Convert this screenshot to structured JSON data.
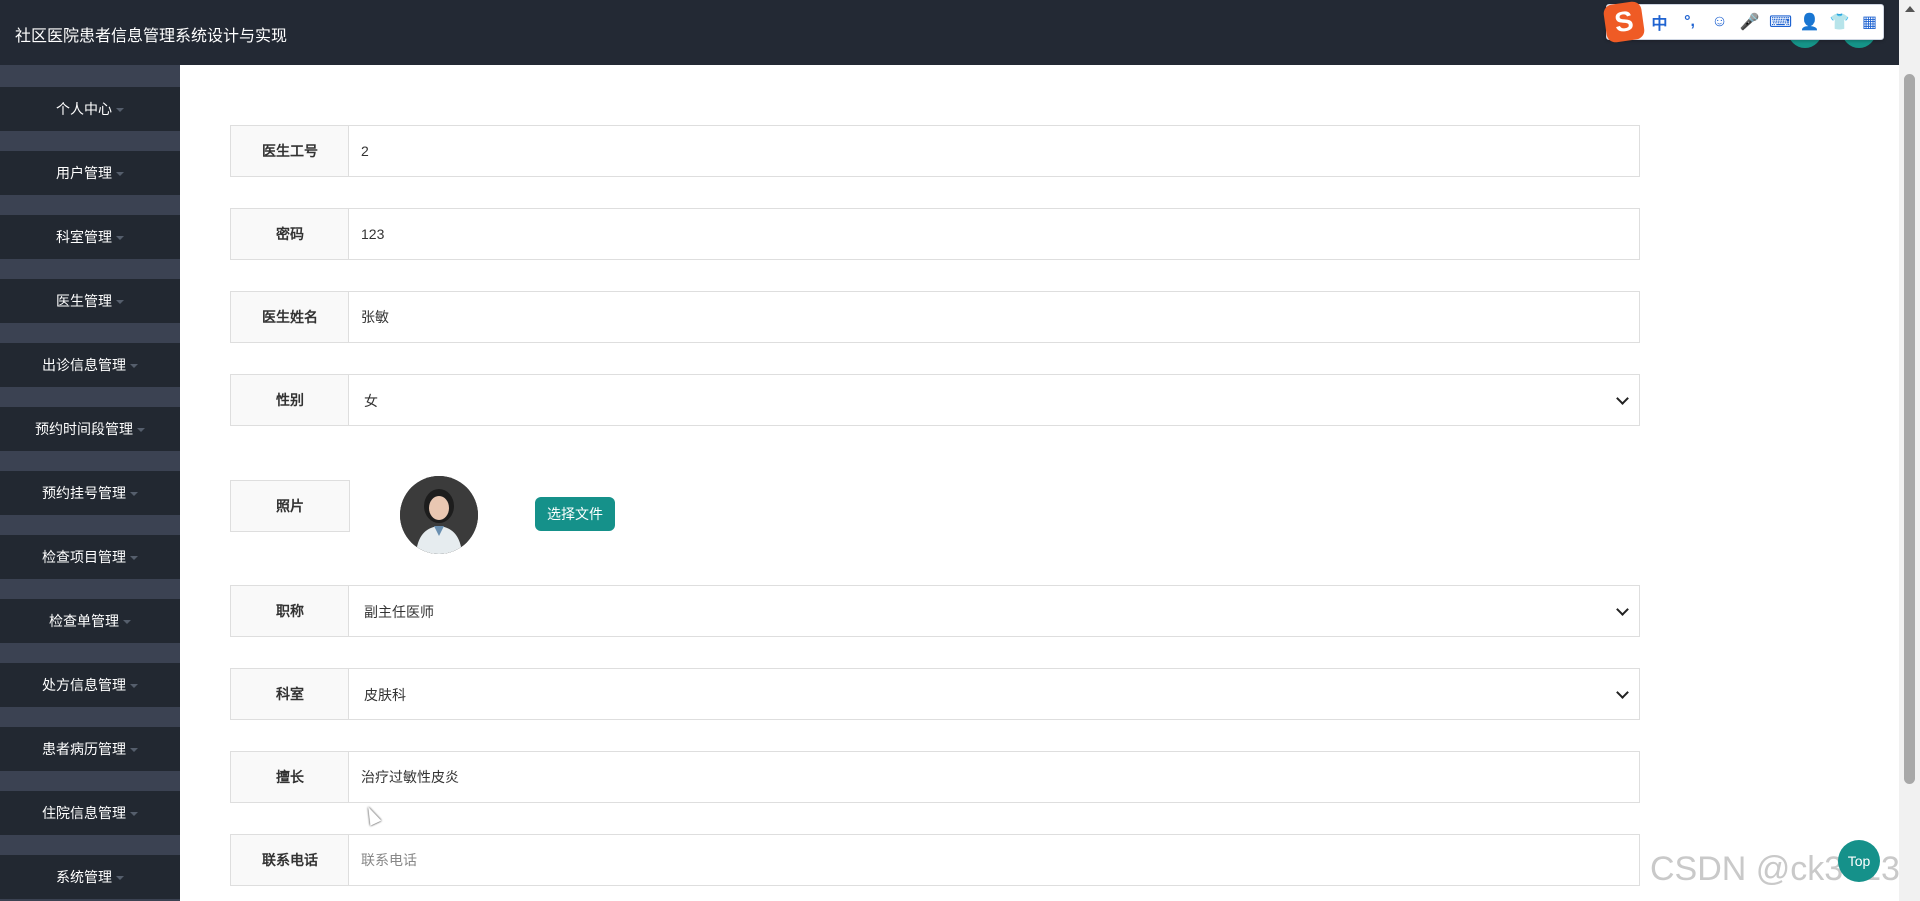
{
  "header": {
    "title": "社区医院患者信息管理系统设计与实现"
  },
  "ime": {
    "logo": "S",
    "items": [
      "中",
      "°,",
      "☺",
      "🎤",
      "⌨",
      "👤",
      "👕",
      "▦"
    ]
  },
  "sidebar": {
    "items": [
      {
        "label": "个人中心"
      },
      {
        "label": "用户管理"
      },
      {
        "label": "科室管理"
      },
      {
        "label": "医生管理"
      },
      {
        "label": "出诊信息管理"
      },
      {
        "label": "预约时间段管理"
      },
      {
        "label": "预约挂号管理"
      },
      {
        "label": "检查项目管理"
      },
      {
        "label": "检查单管理"
      },
      {
        "label": "处方信息管理"
      },
      {
        "label": "患者病历管理"
      },
      {
        "label": "住院信息管理"
      },
      {
        "label": "系统管理"
      }
    ]
  },
  "form": {
    "doctor_id": {
      "label": "医生工号",
      "value": "2"
    },
    "password": {
      "label": "密码",
      "value": "123"
    },
    "doctor_name": {
      "label": "医生姓名",
      "value": "张敏"
    },
    "gender": {
      "label": "性别",
      "value": "女"
    },
    "photo": {
      "label": "照片",
      "button": "选择文件"
    },
    "title": {
      "label": "职称",
      "value": "副主任医师"
    },
    "department": {
      "label": "科室",
      "value": "皮肤科"
    },
    "specialty": {
      "label": "擅长",
      "value": "治疗过敏性皮炎"
    },
    "phone": {
      "label": "联系电话",
      "value": "",
      "placeholder": "联系电话"
    }
  },
  "watermark": "CSDN @ck3013",
  "top_button": "Top",
  "colors": {
    "header_bg": "#232934",
    "sidebar_item_bg": "#222831",
    "sidebar_gap_bg": "#3b4252",
    "accent": "#15918a"
  }
}
